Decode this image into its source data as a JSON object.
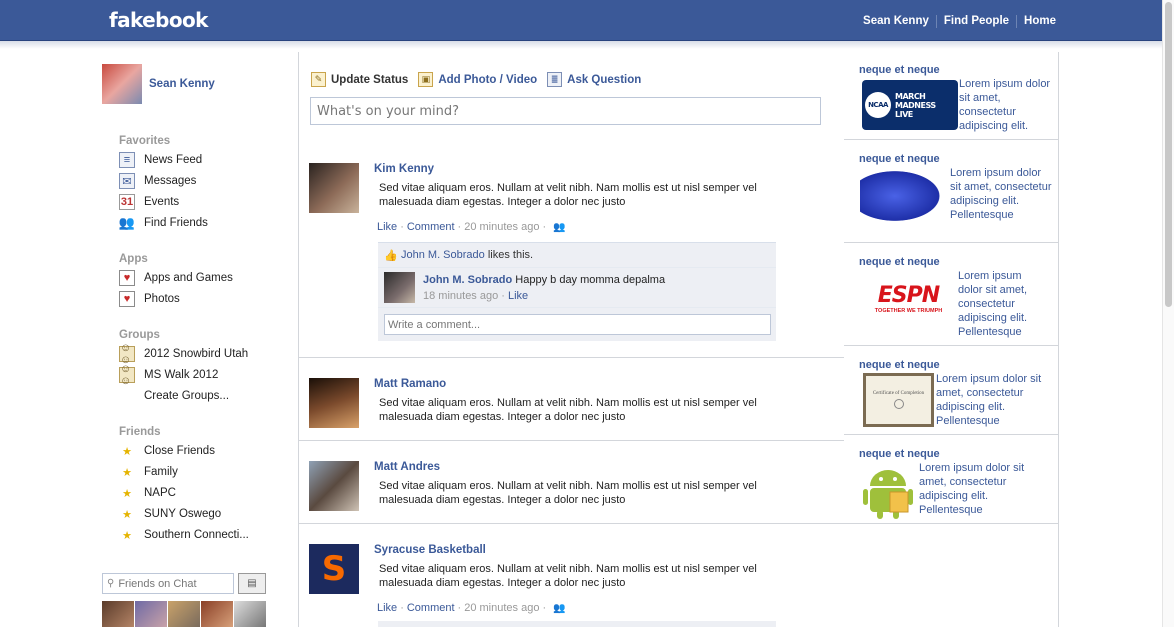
{
  "header": {
    "logo": "fakebook",
    "nav": [
      "Sean Kenny",
      "Find People",
      "Home"
    ]
  },
  "sidebar": {
    "user_name": "Sean Kenny",
    "favorites_heading": "Favorites",
    "favorites": [
      "News Feed",
      "Messages",
      "Events",
      "Find Friends"
    ],
    "apps_heading": "Apps",
    "apps": [
      "Apps and Games",
      "Photos"
    ],
    "groups_heading": "Groups",
    "groups": [
      "2012 Snowbird Utah",
      "MS Walk 2012",
      "Create Groups..."
    ],
    "friends_heading": "Friends",
    "friends": [
      "Close Friends",
      "Family",
      "NAPC",
      "SUNY Oswego",
      "Southern Connecti..."
    ],
    "chat_placeholder": "Friends on Chat"
  },
  "composer": {
    "tabs": [
      "Update Status",
      "Add Photo / Video",
      "Ask Question"
    ],
    "placeholder": "What's on your mind?"
  },
  "posts": [
    {
      "name": "Kim Kenny",
      "text": "Sed vitae aliquam eros. Nullam at velit nibh. Nam mollis est ut nisl semper vel malesuada diam egestas. Integer a dolor nec justo",
      "like": "Like",
      "comment": "Comment",
      "time": "20 minutes ago"
    },
    {
      "name": "Matt Ramano",
      "text": "Sed vitae aliquam eros. Nullam at velit nibh. Nam mollis est ut nisl semper vel malesuada diam egestas. Integer a dolor nec justo"
    },
    {
      "name": "Matt Andres",
      "text": "Sed vitae aliquam eros. Nullam at velit nibh. Nam mollis est ut nisl semper vel malesuada diam egestas. Integer a dolor nec justo"
    },
    {
      "name": "Syracuse Basketball",
      "text": "Sed vitae aliquam eros. Nullam at velit nibh. Nam mollis est ut nisl semper vel malesuada diam egestas. Integer a dolor nec justo",
      "like": "Like",
      "comment": "Comment",
      "time": "20 minutes ago"
    }
  ],
  "ufi": {
    "like_name": "John M. Sobrado",
    "like_suffix": "likes this.",
    "comment_author": "John M. Sobrado",
    "comment_text": "Happy b day momma depalma",
    "comment_time": "18 minutes ago",
    "comment_like": "Like",
    "write_placeholder": "Write a comment..."
  },
  "ads": [
    {
      "title": "neque et neque",
      "text": "Lorem ipsum dolor sit amet, consectetur adipiscing elit.",
      "image_label": "MARCH MADNESS LIVE",
      "image_badge": "NCAA"
    },
    {
      "title": "neque et neque",
      "text": "Lorem ipsum dolor sit amet, consectetur adipiscing elit. Pellentesque"
    },
    {
      "title": "neque et neque",
      "text": "Lorem ipsum dolor sit amet, consectetur adipiscing elit. Pellentesque",
      "image_label": "ESPN",
      "image_sub": "TOGETHER WE TRIUMPH"
    },
    {
      "title": "neque et neque",
      "text": "Lorem ipsum dolor sit amet, consectetur adipiscing elit. Pellentesque",
      "image_label": "Certificate of Completion"
    },
    {
      "title": "neque et neque",
      "text": "Lorem ipsum dolor sit amet, consectetur adipiscing elit. Pellentesque"
    }
  ],
  "colors": {
    "brand": "#3b5998",
    "link": "#3b5998",
    "muted": "#999999",
    "ufi_bg": "#edeff4"
  },
  "icons": {
    "news_feed": "news-feed-icon",
    "messages": "messages-icon",
    "events": "calendar-icon",
    "find_friends": "friends-icon",
    "apps": "heart-app-icon",
    "groups": "group-icon",
    "friend_lists": "star-icon"
  }
}
